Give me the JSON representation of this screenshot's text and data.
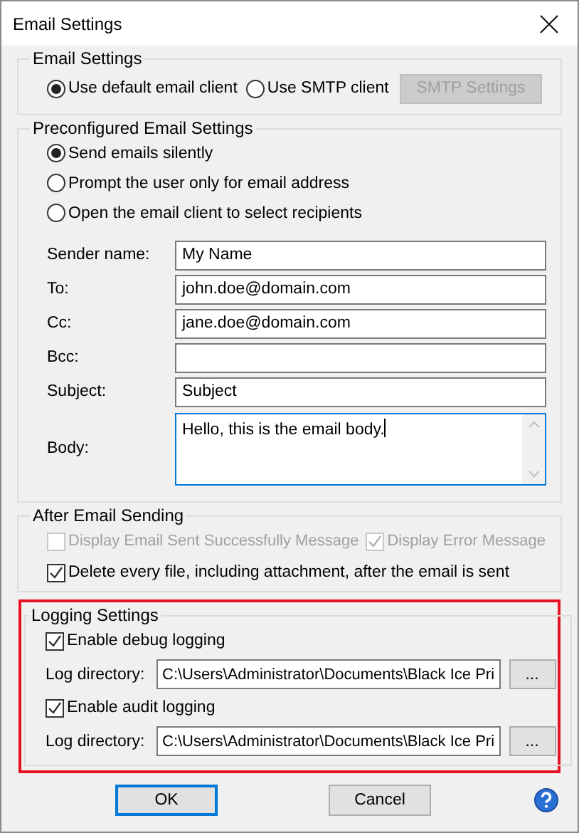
{
  "window": {
    "title": "Email Settings"
  },
  "email_settings": {
    "legend": "Email Settings",
    "options": [
      {
        "label": "Use default email client",
        "selected": true
      },
      {
        "label": "Use SMTP client",
        "selected": false
      }
    ],
    "smtp_button": {
      "label": "SMTP Settings",
      "disabled": true
    }
  },
  "preconfigured": {
    "legend": "Preconfigured Email Settings",
    "options": [
      {
        "label": "Send emails silently",
        "selected": true
      },
      {
        "label": "Prompt the user only for email address",
        "selected": false
      },
      {
        "label": "Open the email client to select recipients",
        "selected": false
      }
    ],
    "fields": [
      {
        "label": "Sender name:",
        "value": "My Name"
      },
      {
        "label": "To:",
        "value": "john.doe@domain.com"
      },
      {
        "label": "Cc:",
        "value": "jane.doe@domain.com"
      },
      {
        "label": "Bcc:"
      },
      {
        "label": "Subject:",
        "value": "Subject"
      }
    ],
    "body": {
      "label": "Body:",
      "value": "Hello, this is the email body.",
      "focused": true
    }
  },
  "after_sending": {
    "legend": "After Email Sending",
    "checkboxes": [
      {
        "label": "Display Email Sent Successfully Message",
        "checked": false,
        "disabled": true
      },
      {
        "label": "Display Error Message",
        "checked": true,
        "disabled": true
      },
      {
        "label": "Delete every file, including attachment, after the email is sent",
        "checked": true,
        "disabled": false
      }
    ]
  },
  "logging": {
    "legend": "Logging Settings",
    "highlighted": true,
    "entries": [
      {
        "label": "Enable debug logging",
        "checked": true,
        "dir_label": "Log directory:",
        "dir_value": "C:\\Users\\Administrator\\Documents\\Black Ice Pri",
        "browse": "..."
      },
      {
        "label": "Enable audit logging",
        "checked": true,
        "dir_label": "Log directory:",
        "dir_value": "C:\\Users\\Administrator\\Documents\\Black Ice Pri",
        "browse": "..."
      }
    ]
  },
  "buttons": [
    {
      "label": "OK",
      "default": true
    },
    {
      "label": "Cancel",
      "default": false
    }
  ]
}
